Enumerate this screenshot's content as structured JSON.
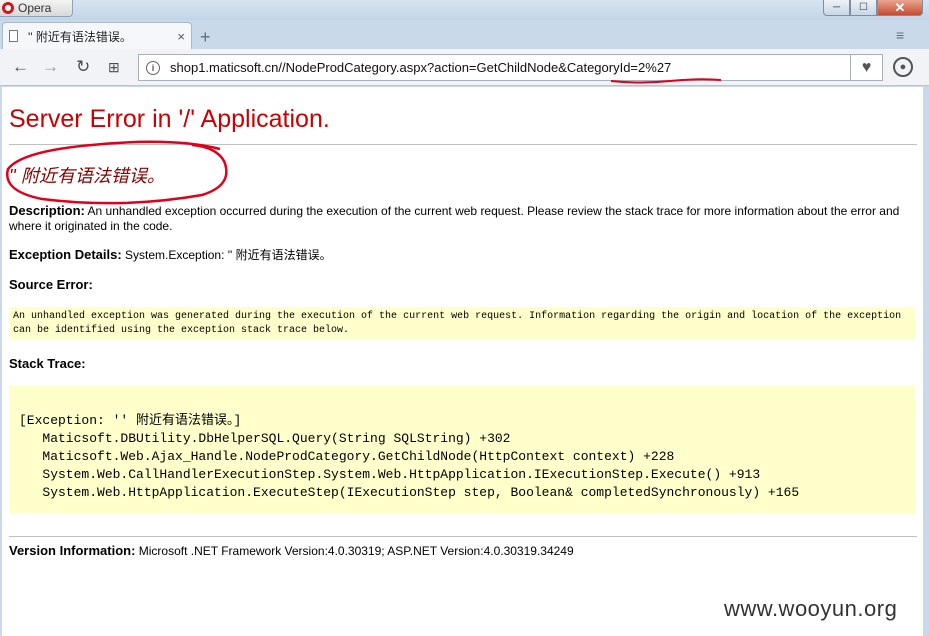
{
  "window": {
    "app_name": "Opera",
    "minimize": "─",
    "maximize": "☐",
    "close": "✕"
  },
  "tab": {
    "title": "'' 附近有语法错误。",
    "close": "×",
    "new_tab": "+",
    "menu": "≡"
  },
  "toolbar": {
    "back": "←",
    "forward": "→",
    "reload": "↻",
    "speed_dial": "⊞",
    "info": "i",
    "url": "shop1.maticsoft.cn//NodeProdCategory.aspx?action=GetChildNode&CategoryId=2%27",
    "favorite": "♥",
    "account": "●"
  },
  "annotation_color": "#e0001b",
  "page": {
    "title": "Server Error in '/' Application.",
    "subtitle": "'' 附近有语法错误。",
    "description_label": "Description:",
    "description_text": " An unhandled exception occurred during the execution of the current web request. Please review the stack trace for more information about the error and where it originated in the code.",
    "exception_label": "Exception Details:",
    "exception_text": " System.Exception: '' 附近有语法错误。",
    "source_error_label": "Source Error:",
    "source_error_text": "An unhandled exception was generated during the execution of the current web request. Information regarding the origin and location of the exception can be identified using the exception stack trace below.",
    "stack_trace_label": "Stack Trace:",
    "stack_trace": "[Exception: '' 附近有语法错误。]\n   Maticsoft.DBUtility.DbHelperSQL.Query(String SQLString) +302\n   Maticsoft.Web.Ajax_Handle.NodeProdCategory.GetChildNode(HttpContext context) +228\n   System.Web.CallHandlerExecutionStep.System.Web.HttpApplication.IExecutionStep.Execute() +913\n   System.Web.HttpApplication.ExecuteStep(IExecutionStep step, Boolean& completedSynchronously) +165",
    "version_label": "Version Information:",
    "version_text": " Microsoft .NET Framework Version:4.0.30319; ASP.NET Version:4.0.30319.34249"
  },
  "watermark": "www.wooyun.org"
}
